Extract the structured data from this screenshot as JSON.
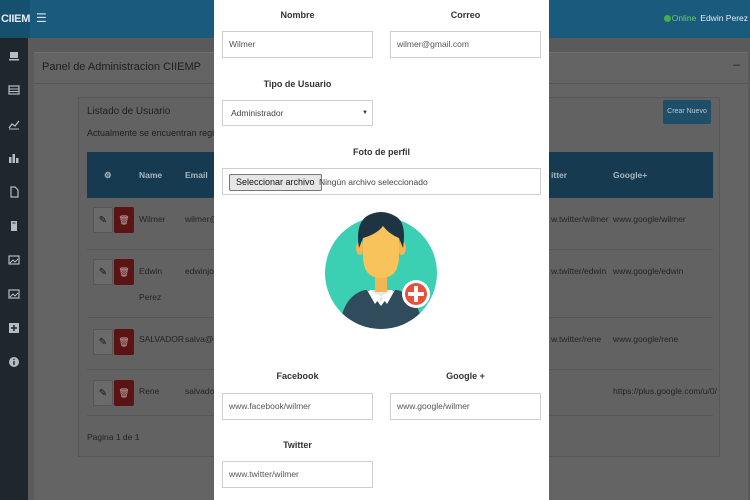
{
  "app": {
    "brand": "CIIEM"
  },
  "user": {
    "status": "Online",
    "name": "Edwin Perez"
  },
  "icons": [
    "hamburger-icon",
    "laptop-icon",
    "list-icon",
    "line-chart-icon",
    "bar-chart-icon",
    "file-icon",
    "book-icon",
    "image-icon",
    "image-icon",
    "plus-square-icon",
    "info-icon",
    "gear-icon",
    "pencil-icon",
    "trash-icon",
    "add-circle-icon",
    "avatar-icon",
    "caret-down-icon"
  ],
  "colors": {
    "header": "#1a5a7c",
    "table_header": "#163a4f",
    "delete": "#c9302c",
    "online": "#42b14a",
    "avatar_bg": "#3bcfb4",
    "add_badge": "#e8503a"
  },
  "panel": {
    "title": "Panel de Administracion CIIEMP"
  },
  "listing": {
    "title": "Listado de Usuario",
    "subtitle": "Actualmente se encuentran registra",
    "create_button": "Crear Nuevo",
    "columns": {
      "name": "Name",
      "email": "Email",
      "twitter": "itter",
      "google": "Google+"
    },
    "rows": [
      {
        "name": "Wilmer",
        "email": "wilmer@",
        "twitter": "w.twitter/wilmer",
        "google": "www.google/wilmer"
      },
      {
        "name": "Edwin",
        "name2": "Perez",
        "email": "edwinjos",
        "twitter": "w.twitter/edwin",
        "google": "www.google/edwin"
      },
      {
        "name": "SALVADOR",
        "email": "salva@g",
        "twitter": "w.twitter/rene",
        "google": "www.google/rene"
      },
      {
        "name": "Rene",
        "email": "salvador",
        "twitter": "",
        "google": "https://plus.google.com/u/0/"
      }
    ],
    "pagination": "Pagina 1 de 1"
  },
  "form": {
    "nombre": {
      "label": "Nombre",
      "value": "Wilmer"
    },
    "correo": {
      "label": "Correo",
      "value": "wilmer@gmail.com"
    },
    "tipo": {
      "label": "Tipo de Usuario",
      "value": "Administrador"
    },
    "foto": {
      "label": "Foto de perfil",
      "button": "Seleccionar archivo",
      "status": "Ningún archivo seleccionado"
    },
    "facebook": {
      "label": "Facebook",
      "value": "www.facebook/wilmer"
    },
    "google": {
      "label": "Google +",
      "value": "www.google/wilmer"
    },
    "twitter": {
      "label": "Twitter",
      "value": "www.twitter/wilmer"
    }
  }
}
